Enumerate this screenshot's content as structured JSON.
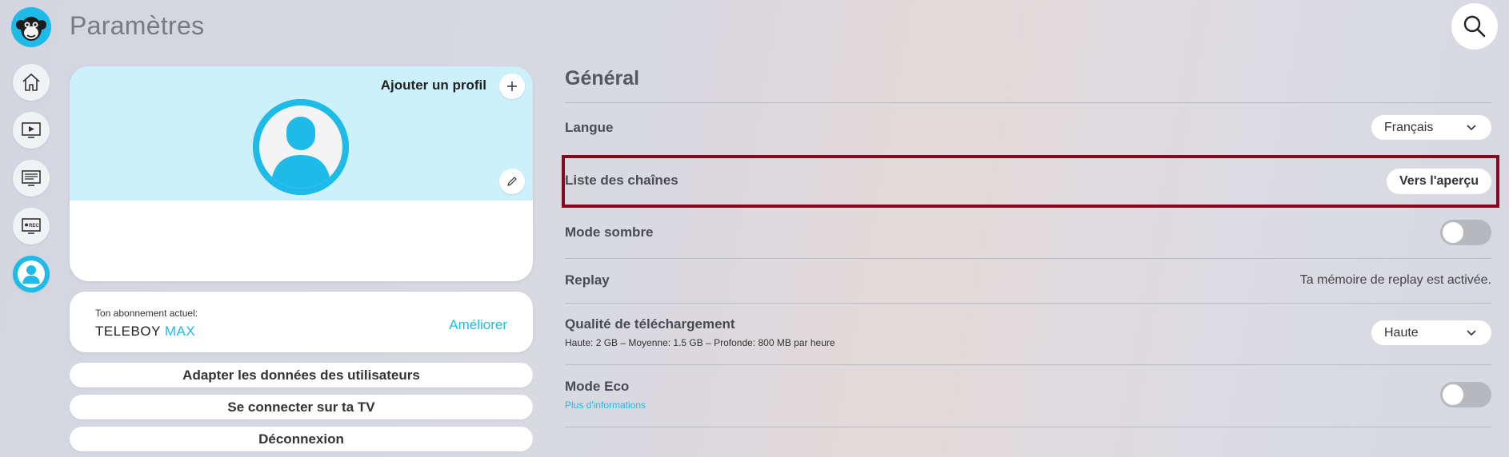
{
  "header": {
    "title": "Paramètres",
    "logo_icon": "monkey-logo-icon",
    "search_icon": "search-icon"
  },
  "nav": {
    "items": [
      {
        "name": "home",
        "icon": "home-icon"
      },
      {
        "name": "live-tv",
        "icon": "play-screen-icon"
      },
      {
        "name": "tv-guide",
        "icon": "guide-screen-icon"
      },
      {
        "name": "recordings",
        "icon": "rec-screen-icon"
      },
      {
        "name": "profile",
        "icon": "user-icon",
        "active": true
      }
    ]
  },
  "profile": {
    "add_label": "Ajouter un profil",
    "add_icon": "plus-icon",
    "edit_icon": "pencil-icon",
    "avatar_icon": "user-avatar-icon"
  },
  "subscription": {
    "label": "Ton abonnement actuel:",
    "plan_name": "TELEBOY",
    "plan_tier": "MAX",
    "upgrade_label": "Améliorer"
  },
  "account_actions": {
    "edit_user_data": "Adapter les données des utilisateurs",
    "connect_tv": "Se connecter sur ta TV",
    "logout": "Déconnexion"
  },
  "settings": {
    "section_title": "Général",
    "language": {
      "label": "Langue",
      "value": "Français"
    },
    "channel_list": {
      "label": "Liste des chaînes",
      "button": "Vers l'aperçu"
    },
    "dark_mode": {
      "label": "Mode sombre",
      "enabled": false
    },
    "replay": {
      "label": "Replay",
      "status": "Ta mémoire de replay est activée."
    },
    "download_quality": {
      "label": "Qualité de téléchargement",
      "description": "Haute: 2 GB – Moyenne: 1.5 GB – Profonde: 800 MB par heure",
      "value": "Haute"
    },
    "eco_mode": {
      "label": "Mode Eco",
      "link": "Plus d'informations",
      "enabled": false
    }
  },
  "colors": {
    "accent": "#1ebbe8",
    "highlight_border": "#7f0c1f",
    "profile_header_bg": "#cdf1fb"
  }
}
